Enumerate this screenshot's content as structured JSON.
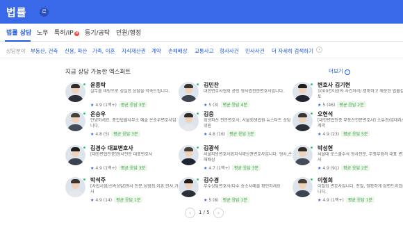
{
  "header": {
    "title": "법률",
    "badge": "로"
  },
  "tabs": [
    {
      "label": "법률 상담"
    },
    {
      "label": "노무"
    },
    {
      "label": "특허/IP",
      "new_badge": "N"
    },
    {
      "label": "등기/공탁"
    },
    {
      "label": "민원/행정"
    }
  ],
  "categories": {
    "label": "상담분야",
    "items": [
      "부동산, 건축",
      "신용, 파산",
      "가족, 이혼",
      "지식재산권",
      "계약",
      "손해배상",
      "교통사고",
      "형사사건",
      "민사사건",
      "더 자세히 검색하기"
    ],
    "more_icon": "chevron-right-icon"
  },
  "section": {
    "title": "지금 상담 가능한 엑스퍼트",
    "more_label": "더보기"
  },
  "experts": [
    {
      "name": "윤종탁",
      "desc": "실무를 바탕으로 성실한 상담을 약속드립니다.",
      "rating": "4.9",
      "count": "(1백+)",
      "response": "평균 응답 3분"
    },
    {
      "name": "김민찬",
      "desc": "대한변호사협회 공인 형사법전문변호사입니다.",
      "rating": "5",
      "count": "(3)",
      "response": "평균 응답 4분"
    },
    {
      "name": "변호사 김기현",
      "desc": "1000건이상의 사건처리/ 명확하고 깨끗한 법률검토",
      "rating": "5",
      "count": "(46)",
      "response": "평균 응답 2분"
    },
    {
      "name": "온승우",
      "desc": "안녕하세요. 종합법률사무소 예솔 온승우변호사입니다.",
      "rating": "4.8",
      "count": "(5)",
      "response": "평균 응답 3분"
    },
    {
      "name": "김웅",
      "desc": "회생파산 전문변호사, 서울회생법원 뉴스타트 상담위원",
      "rating": "4.8",
      "count": "(16)",
      "response": "평균 응답 3분"
    },
    {
      "name": "오현석",
      "desc": "[대한변협인증 부동산전문변호사] 소유권/임대차/계약",
      "rating": "4.9",
      "count": "(23)",
      "response": "평균 응답 5분"
    },
    {
      "name": "김경수 대표변호사",
      "desc": "[대한변협인증]형사전문 대표변호사",
      "rating": "4.9",
      "count": "(1백+)",
      "response": "평균 응답 3분"
    },
    {
      "name": "김광석",
      "desc": "서울지방변호사회지식재산권변호사입니다. 형사,손해배상",
      "rating": "4.7",
      "count": "(1백+)",
      "response": "평균 응답 3분"
    },
    {
      "name": "박성현",
      "desc": "서울대 로스쿨수석 형사전문, 무죄무혐의 대표 변호사",
      "rating": "4.9",
      "count": "(91)",
      "response": "평균 응답 2분"
    },
    {
      "name": "박석주",
      "desc": "[사법시험/선속상담]형사 전문,성범죄,이혼,민사,가사",
      "rating": "4.9",
      "count": "(14)",
      "response": "평균 응답 1분"
    },
    {
      "name": "김수경",
      "desc": "무수상담변호사/다수 승소사례를 확인하세요",
      "rating": "5",
      "count": "(8)",
      "response": "평균 응답 1분"
    },
    {
      "name": "이철희",
      "desc": "이철희 변호사입니다. 친절, 정확하게 답변드리겠습니다.",
      "rating": "4.9",
      "count": "(1백+)",
      "response": "평균 응답 1분"
    }
  ],
  "pagination": {
    "text": "1 / 5",
    "prev_icon": "chevron-left-icon",
    "next_icon": "chevron-right-icon"
  },
  "colors": {
    "brand": "#3968e8",
    "accent": "#1f56e0",
    "online": "#2fd178"
  }
}
